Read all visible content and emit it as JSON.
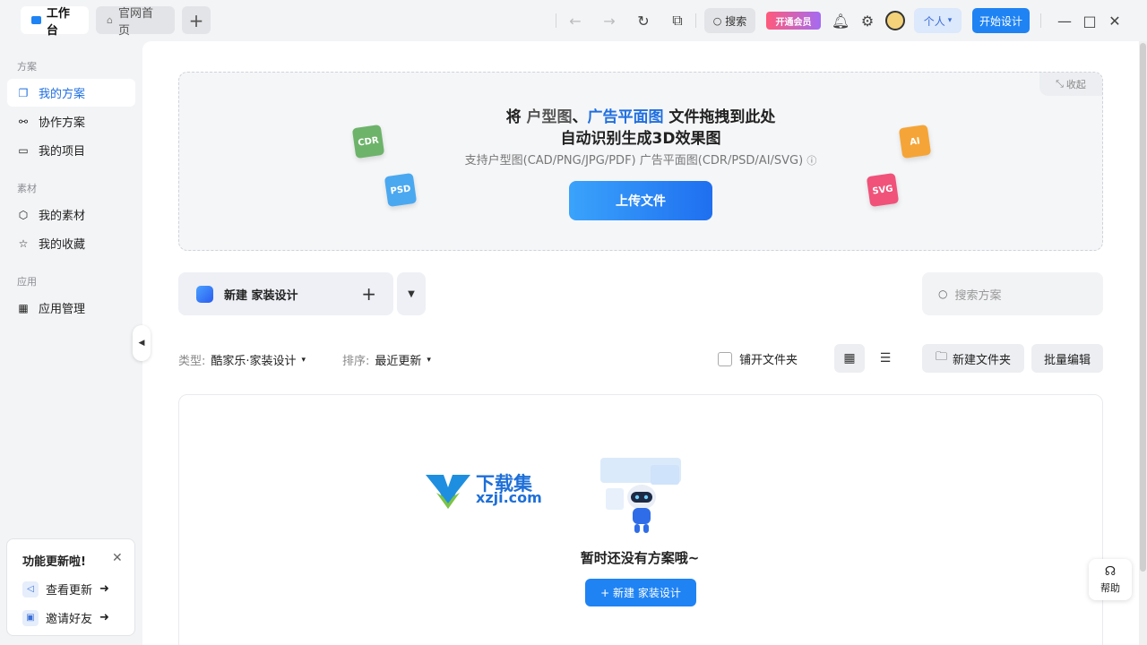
{
  "tabs": {
    "workbench": "工作台",
    "homepage": "官网首页",
    "add": "+"
  },
  "toolbar": {
    "search": "搜索",
    "vip": "开通会员",
    "personal": "个人",
    "start_design": "开始设计"
  },
  "sidebar": {
    "groups": [
      {
        "label": "方案",
        "items": [
          "我的方案",
          "协作方案",
          "我的项目"
        ]
      },
      {
        "label": "素材",
        "items": [
          "我的素材",
          "我的收藏"
        ]
      },
      {
        "label": "应用",
        "items": [
          "应用管理"
        ]
      }
    ],
    "active_item": "我的方案"
  },
  "notice": {
    "title": "功能更新啦!",
    "items": [
      "查看更新",
      "邀请好友"
    ]
  },
  "dropzone": {
    "collapse": "收起",
    "title_prefix": "将",
    "title_hl1": "户型图",
    "title_sep": "、",
    "title_hl2": "广告平面图",
    "title_suffix": "文件拖拽到此处",
    "title_line2": "自动识别生成3D效果图",
    "subtitle": "支持户型图(CAD/PNG/JPG/PDF) 广告平面图(CDR/PSD/AI/SVG)",
    "upload": "上传文件",
    "badges": [
      {
        "label": "CDR",
        "color": "#6db36a"
      },
      {
        "label": "PSD",
        "color": "#4aa8f0"
      },
      {
        "label": "AI",
        "color": "#f5a537"
      },
      {
        "label": "SVG",
        "color": "#f0527a"
      }
    ]
  },
  "actions": {
    "new_design": "新建 家装设计",
    "search_placeholder": "搜索方案",
    "type_key": "类型:",
    "type_value": "酷家乐·家装设计",
    "sort_key": "排序:",
    "sort_value": "最近更新",
    "flatten_folders": "铺开文件夹",
    "new_folder": "新建文件夹",
    "batch_edit": "批量编辑"
  },
  "empty": {
    "watermark_title": "下载集",
    "watermark_url": "xzji.com",
    "message": "暂时还没有方案哦~",
    "new_button": "+ 新建 家装设计"
  },
  "help": "帮助",
  "colors": {
    "accent": "#1f83f4",
    "active_text": "#1f6fe0"
  }
}
